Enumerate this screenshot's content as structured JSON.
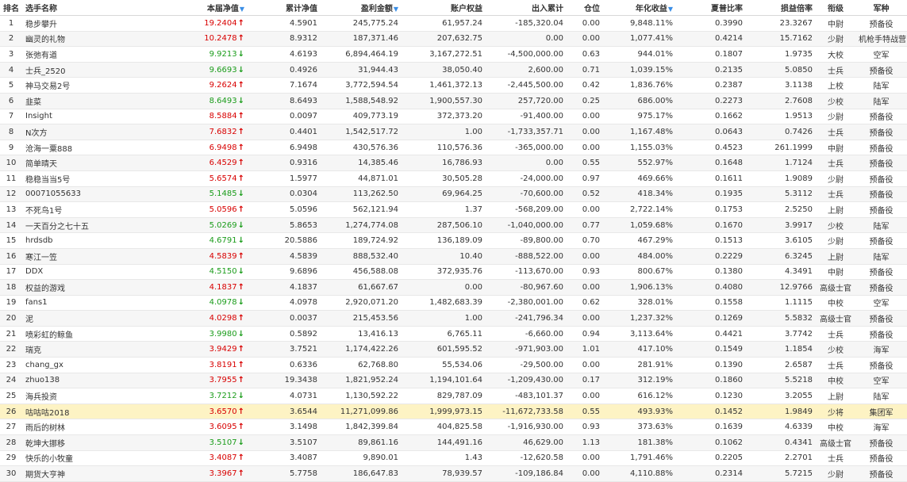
{
  "headers": {
    "rank": "排名",
    "name": "选手名称",
    "nav": "本届净值",
    "cum_nav": "累计净值",
    "profit": "盈利金额",
    "equity": "账户权益",
    "inout": "出入累计",
    "position": "仓位",
    "annual": "年化收益",
    "sharpe": "夏普比率",
    "pl_ratio": "损益倍率",
    "rank_title": "衔级",
    "arm": "军种"
  },
  "sort_icon": "triangle-down-icon",
  "colors": {
    "up": "#d80000",
    "down": "#1a9c1a",
    "highlight": "#fdf3c4",
    "sort": "#3a8ee6"
  },
  "rows": [
    {
      "rank": "1",
      "name": "稳步攀升",
      "nav": "19.2404",
      "dir": "up",
      "cum_nav": "4.5901",
      "profit": "245,775.24",
      "equity": "61,957.24",
      "inout": "-185,320.04",
      "pos": "0.00",
      "annual": "9,848.11%",
      "sharpe": "0.3990",
      "pl": "23.3267",
      "title": "中尉",
      "arm": "预备役"
    },
    {
      "rank": "2",
      "name": "幽灵的礼物",
      "nav": "10.2478",
      "dir": "up",
      "cum_nav": "8.9312",
      "profit": "187,371.46",
      "equity": "207,632.75",
      "inout": "0.00",
      "pos": "0.00",
      "annual": "1,077.41%",
      "sharpe": "0.4214",
      "pl": "15.7162",
      "title": "少尉",
      "arm": "机枪手特战营"
    },
    {
      "rank": "3",
      "name": "张弛有道",
      "nav": "9.9213",
      "dir": "down",
      "cum_nav": "4.6193",
      "profit": "6,894,464.19",
      "equity": "3,167,272.51",
      "inout": "-4,500,000.00",
      "pos": "0.63",
      "annual": "944.01%",
      "sharpe": "0.1807",
      "pl": "1.9735",
      "title": "大校",
      "arm": "空军"
    },
    {
      "rank": "4",
      "name": "士兵_2520",
      "nav": "9.6693",
      "dir": "down",
      "cum_nav": "0.4926",
      "profit": "31,944.43",
      "equity": "38,050.40",
      "inout": "2,600.00",
      "pos": "0.71",
      "annual": "1,039.15%",
      "sharpe": "0.2135",
      "pl": "5.0850",
      "title": "士兵",
      "arm": "预备役"
    },
    {
      "rank": "5",
      "name": "神马交易2号",
      "nav": "9.2624",
      "dir": "up",
      "cum_nav": "7.1674",
      "profit": "3,772,594.54",
      "equity": "1,461,372.13",
      "inout": "-2,445,500.00",
      "pos": "0.42",
      "annual": "1,836.76%",
      "sharpe": "0.2387",
      "pl": "3.1138",
      "title": "上校",
      "arm": "陆军"
    },
    {
      "rank": "6",
      "name": "韭菜",
      "nav": "8.6493",
      "dir": "down",
      "cum_nav": "8.6493",
      "profit": "1,588,548.92",
      "equity": "1,900,557.30",
      "inout": "257,720.00",
      "pos": "0.25",
      "annual": "686.00%",
      "sharpe": "0.2273",
      "pl": "2.7608",
      "title": "少校",
      "arm": "陆军"
    },
    {
      "rank": "7",
      "name": "Insight",
      "nav": "8.5884",
      "dir": "up",
      "cum_nav": "0.0097",
      "profit": "409,773.19",
      "equity": "372,373.20",
      "inout": "-91,400.00",
      "pos": "0.00",
      "annual": "975.17%",
      "sharpe": "0.1662",
      "pl": "1.9513",
      "title": "少尉",
      "arm": "预备役"
    },
    {
      "rank": "8",
      "name": "N次方",
      "nav": "7.6832",
      "dir": "up",
      "cum_nav": "0.4401",
      "profit": "1,542,517.72",
      "equity": "1.00",
      "inout": "-1,733,357.71",
      "pos": "0.00",
      "annual": "1,167.48%",
      "sharpe": "0.0643",
      "pl": "0.7426",
      "title": "士兵",
      "arm": "预备役"
    },
    {
      "rank": "9",
      "name": "沧海一粟888",
      "nav": "6.9498",
      "dir": "up",
      "cum_nav": "6.9498",
      "profit": "430,576.36",
      "equity": "110,576.36",
      "inout": "-365,000.00",
      "pos": "0.00",
      "annual": "1,155.03%",
      "sharpe": "0.4523",
      "pl": "261.1999",
      "title": "中尉",
      "arm": "预备役"
    },
    {
      "rank": "10",
      "name": "简单晴天",
      "nav": "6.4529",
      "dir": "up",
      "cum_nav": "0.9316",
      "profit": "14,385.46",
      "equity": "16,786.93",
      "inout": "0.00",
      "pos": "0.55",
      "annual": "552.97%",
      "sharpe": "0.1648",
      "pl": "1.7124",
      "title": "士兵",
      "arm": "预备役"
    },
    {
      "rank": "11",
      "name": "稳稳当当5号",
      "nav": "5.6574",
      "dir": "up",
      "cum_nav": "1.5977",
      "profit": "44,871.01",
      "equity": "30,505.28",
      "inout": "-24,000.00",
      "pos": "0.97",
      "annual": "469.66%",
      "sharpe": "0.1611",
      "pl": "1.9089",
      "title": "少尉",
      "arm": "预备役"
    },
    {
      "rank": "12",
      "name": "00071055633",
      "nav": "5.1485",
      "dir": "down",
      "cum_nav": "0.0304",
      "profit": "113,262.50",
      "equity": "69,964.25",
      "inout": "-70,600.00",
      "pos": "0.52",
      "annual": "418.34%",
      "sharpe": "0.1935",
      "pl": "5.3112",
      "title": "士兵",
      "arm": "预备役"
    },
    {
      "rank": "13",
      "name": "不死鸟1号",
      "nav": "5.0596",
      "dir": "up",
      "cum_nav": "5.0596",
      "profit": "562,121.94",
      "equity": "1.37",
      "inout": "-568,209.00",
      "pos": "0.00",
      "annual": "2,722.14%",
      "sharpe": "0.1753",
      "pl": "2.5250",
      "title": "上尉",
      "arm": "预备役"
    },
    {
      "rank": "14",
      "name": "一天百分之七十五",
      "nav": "5.0269",
      "dir": "down",
      "cum_nav": "5.8653",
      "profit": "1,274,774.08",
      "equity": "287,506.10",
      "inout": "-1,040,000.00",
      "pos": "0.77",
      "annual": "1,059.68%",
      "sharpe": "0.1670",
      "pl": "3.9917",
      "title": "少校",
      "arm": "陆军"
    },
    {
      "rank": "15",
      "name": "hrdsdb",
      "nav": "4.6791",
      "dir": "down",
      "cum_nav": "20.5886",
      "profit": "189,724.92",
      "equity": "136,189.09",
      "inout": "-89,800.00",
      "pos": "0.70",
      "annual": "467.29%",
      "sharpe": "0.1513",
      "pl": "3.6105",
      "title": "少尉",
      "arm": "预备役"
    },
    {
      "rank": "16",
      "name": "寒江一笠",
      "nav": "4.5839",
      "dir": "up",
      "cum_nav": "4.5839",
      "profit": "888,532.40",
      "equity": "10.40",
      "inout": "-888,522.00",
      "pos": "0.00",
      "annual": "484.00%",
      "sharpe": "0.2229",
      "pl": "6.3245",
      "title": "上尉",
      "arm": "陆军"
    },
    {
      "rank": "17",
      "name": "DDX",
      "nav": "4.5150",
      "dir": "down",
      "cum_nav": "9.6896",
      "profit": "456,588.08",
      "equity": "372,935.76",
      "inout": "-113,670.00",
      "pos": "0.93",
      "annual": "800.67%",
      "sharpe": "0.1380",
      "pl": "4.3491",
      "title": "中尉",
      "arm": "预备役"
    },
    {
      "rank": "18",
      "name": "权益的游戏",
      "nav": "4.1837",
      "dir": "up",
      "cum_nav": "4.1837",
      "profit": "61,667.67",
      "equity": "0.00",
      "inout": "-80,967.60",
      "pos": "0.00",
      "annual": "1,906.13%",
      "sharpe": "0.4080",
      "pl": "12.9766",
      "title": "高级士官",
      "arm": "预备役"
    },
    {
      "rank": "19",
      "name": "fans1",
      "nav": "4.0978",
      "dir": "down",
      "cum_nav": "4.0978",
      "profit": "2,920,071.20",
      "equity": "1,482,683.39",
      "inout": "-2,380,001.00",
      "pos": "0.62",
      "annual": "328.01%",
      "sharpe": "0.1558",
      "pl": "1.1115",
      "title": "中校",
      "arm": "空军"
    },
    {
      "rank": "20",
      "name": "泥",
      "nav": "4.0298",
      "dir": "up",
      "cum_nav": "0.0037",
      "profit": "215,453.56",
      "equity": "1.00",
      "inout": "-241,796.34",
      "pos": "0.00",
      "annual": "1,237.32%",
      "sharpe": "0.1269",
      "pl": "5.5832",
      "title": "高级士官",
      "arm": "预备役"
    },
    {
      "rank": "21",
      "name": "喷彩虹的鲸鱼",
      "nav": "3.9980",
      "dir": "down",
      "cum_nav": "0.5892",
      "profit": "13,416.13",
      "equity": "6,765.11",
      "inout": "-6,660.00",
      "pos": "0.94",
      "annual": "3,113.64%",
      "sharpe": "0.4421",
      "pl": "3.7742",
      "title": "士兵",
      "arm": "预备役"
    },
    {
      "rank": "22",
      "name": "瑞克",
      "nav": "3.9429",
      "dir": "up",
      "cum_nav": "3.7521",
      "profit": "1,174,422.26",
      "equity": "601,595.52",
      "inout": "-971,903.00",
      "pos": "1.01",
      "annual": "417.10%",
      "sharpe": "0.1549",
      "pl": "1.1854",
      "title": "少校",
      "arm": "海军"
    },
    {
      "rank": "23",
      "name": "chang_gx",
      "nav": "3.8191",
      "dir": "up",
      "cum_nav": "0.6336",
      "profit": "62,768.80",
      "equity": "55,534.06",
      "inout": "-29,500.00",
      "pos": "0.00",
      "annual": "281.91%",
      "sharpe": "0.1390",
      "pl": "2.6587",
      "title": "士兵",
      "arm": "预备役"
    },
    {
      "rank": "24",
      "name": "zhuo138",
      "nav": "3.7955",
      "dir": "up",
      "cum_nav": "19.3438",
      "profit": "1,821,952.24",
      "equity": "1,194,101.64",
      "inout": "-1,209,430.00",
      "pos": "0.17",
      "annual": "312.19%",
      "sharpe": "0.1860",
      "pl": "5.5218",
      "title": "中校",
      "arm": "空军"
    },
    {
      "rank": "25",
      "name": "海兵投资",
      "nav": "3.7212",
      "dir": "down",
      "cum_nav": "4.0731",
      "profit": "1,130,592.22",
      "equity": "829,787.09",
      "inout": "-483,101.37",
      "pos": "0.00",
      "annual": "616.12%",
      "sharpe": "0.1230",
      "pl": "3.2055",
      "title": "上尉",
      "arm": "陆军"
    },
    {
      "rank": "26",
      "name": "咕咕咕2018",
      "nav": "3.6570",
      "dir": "up",
      "cum_nav": "3.6544",
      "profit": "11,271,099.86",
      "equity": "1,999,973.15",
      "inout": "-11,672,733.58",
      "pos": "0.55",
      "annual": "493.93%",
      "sharpe": "0.1452",
      "pl": "1.9849",
      "title": "少将",
      "arm": "集团军",
      "highlight": true
    },
    {
      "rank": "27",
      "name": "雨后的树林",
      "nav": "3.6095",
      "dir": "up",
      "cum_nav": "3.1498",
      "profit": "1,842,399.84",
      "equity": "404,825.58",
      "inout": "-1,916,930.00",
      "pos": "0.93",
      "annual": "373.63%",
      "sharpe": "0.1639",
      "pl": "4.6339",
      "title": "中校",
      "arm": "海军"
    },
    {
      "rank": "28",
      "name": "乾坤大挪移",
      "nav": "3.5107",
      "dir": "down",
      "cum_nav": "3.5107",
      "profit": "89,861.16",
      "equity": "144,491.16",
      "inout": "46,629.00",
      "pos": "1.13",
      "annual": "181.38%",
      "sharpe": "0.1062",
      "pl": "0.4341",
      "title": "高级士官",
      "arm": "预备役"
    },
    {
      "rank": "29",
      "name": "快乐的小牧童",
      "nav": "3.4087",
      "dir": "up",
      "cum_nav": "3.4087",
      "profit": "9,890.01",
      "equity": "1.43",
      "inout": "-12,620.58",
      "pos": "0.00",
      "annual": "1,791.46%",
      "sharpe": "0.2205",
      "pl": "2.2701",
      "title": "士兵",
      "arm": "预备役"
    },
    {
      "rank": "30",
      "name": "期货大亨神",
      "nav": "3.3967",
      "dir": "up",
      "cum_nav": "5.7758",
      "profit": "186,647.83",
      "equity": "78,939.57",
      "inout": "-109,186.84",
      "pos": "0.00",
      "annual": "4,110.88%",
      "sharpe": "0.2314",
      "pl": "5.7215",
      "title": "少尉",
      "arm": "预备役"
    }
  ]
}
